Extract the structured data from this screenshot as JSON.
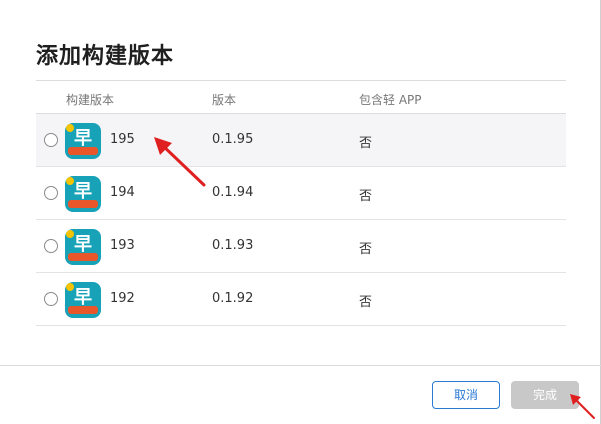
{
  "dialog": {
    "title": "添加构建版本",
    "columns": {
      "build": "构建版本",
      "version": "版本",
      "lite_app": "包含轻 APP"
    },
    "rows": [
      {
        "build": "195",
        "version": "0.1.95",
        "lite_app": "否",
        "icon_label": "早"
      },
      {
        "build": "194",
        "version": "0.1.94",
        "lite_app": "否",
        "icon_label": "早"
      },
      {
        "build": "193",
        "version": "0.1.93",
        "lite_app": "否",
        "icon_label": "早"
      },
      {
        "build": "192",
        "version": "0.1.92",
        "lite_app": "否",
        "icon_label": "早"
      }
    ],
    "buttons": {
      "cancel": "取消",
      "done": "完成"
    }
  },
  "colors": {
    "accent": "#2a7ad4",
    "disabled": "#c8c8c8",
    "annotation": "#e02020",
    "icon_bg": "#17a2b8"
  }
}
